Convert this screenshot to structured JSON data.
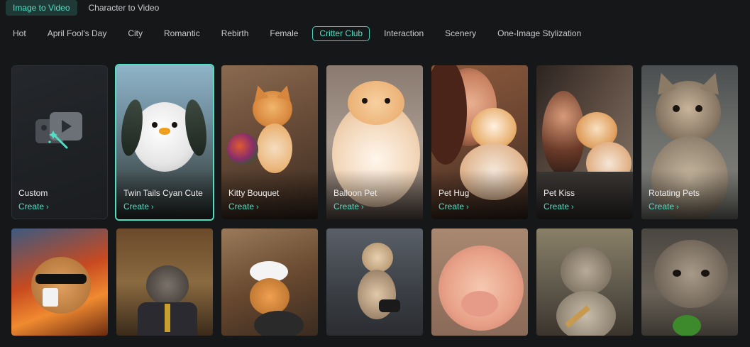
{
  "mode_tabs": [
    {
      "label": "Image to Video",
      "active": true
    },
    {
      "label": "Character to Video",
      "active": false
    }
  ],
  "categories": [
    {
      "label": "Hot"
    },
    {
      "label": "April Fool's Day"
    },
    {
      "label": "City"
    },
    {
      "label": "Romantic"
    },
    {
      "label": "Rebirth"
    },
    {
      "label": "Female"
    },
    {
      "label": "Critter Club",
      "active": true
    },
    {
      "label": "Interaction"
    },
    {
      "label": "Scenery"
    },
    {
      "label": "One-Image Stylization"
    }
  ],
  "cards": [
    {
      "title": "Custom",
      "action": "Create",
      "icon": "image-to-video-magic-icon"
    },
    {
      "title": "Twin Tails Cyan Cute",
      "action": "Create",
      "selected": true
    },
    {
      "title": "Kitty Bouquet",
      "action": "Create"
    },
    {
      "title": "Balloon Pet",
      "action": "Create"
    },
    {
      "title": "Pet Hug",
      "action": "Create"
    },
    {
      "title": "Pet Kiss",
      "action": "Create"
    },
    {
      "title": "Rotating Pets",
      "action": "Create"
    }
  ],
  "accent_color": "#4fe0c4",
  "background_color": "#151719"
}
